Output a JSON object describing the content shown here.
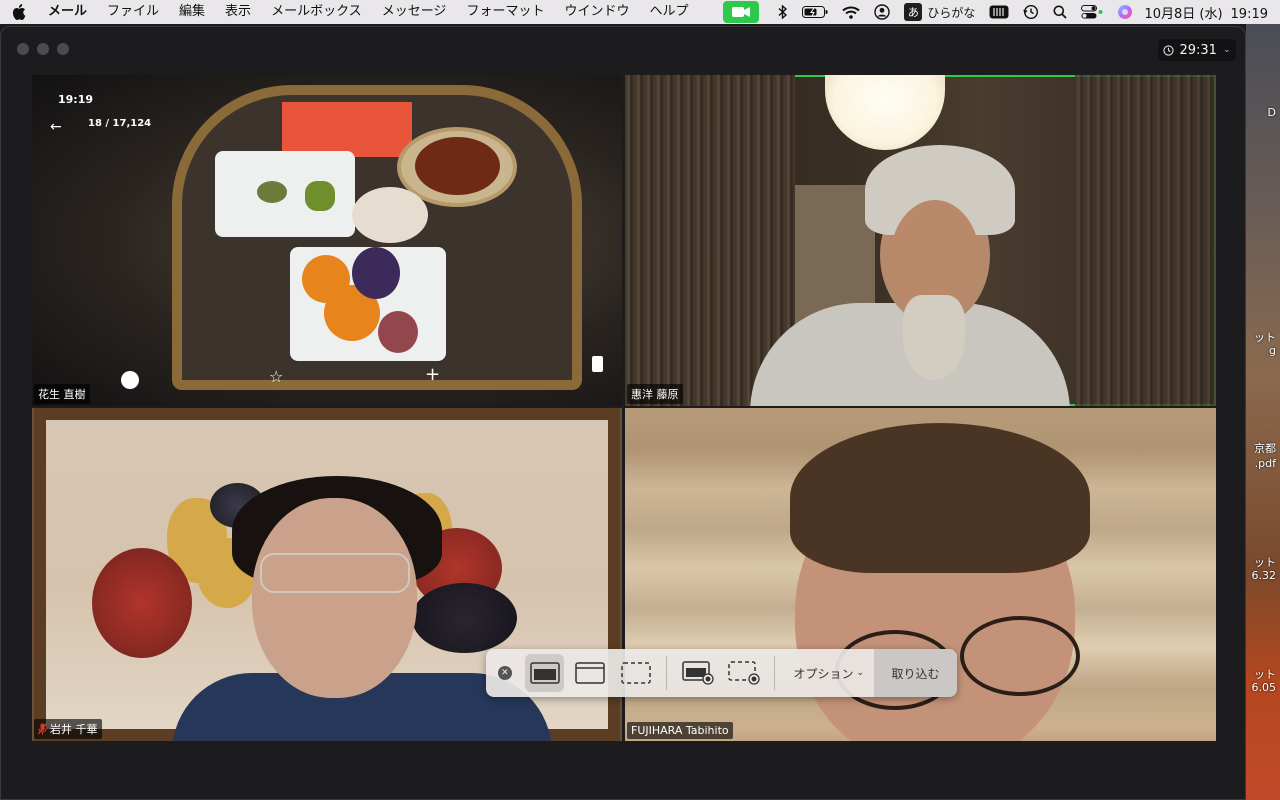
{
  "menubar": {
    "app_name": "メール",
    "items": [
      "ファイル",
      "編集",
      "表示",
      "メールボックス",
      "メッセージ",
      "フォーマット",
      "ウインドウ",
      "ヘルプ"
    ],
    "ime_char": "あ",
    "ime_label": "ひらがな",
    "date": "10月8日 (水)",
    "time": "19:19"
  },
  "zoom": {
    "meeting_timer": "29:31",
    "participants": [
      {
        "name": "花生 直樹",
        "muted": false,
        "active": false
      },
      {
        "name": "惠洋 藤原",
        "muted": false,
        "active": true
      },
      {
        "name": "岩井 千華",
        "muted": true,
        "active": false
      },
      {
        "name": "FUJIHARA Tabihito",
        "muted": false,
        "active": false
      }
    ],
    "shared_phone_screen": {
      "clock": "19:19",
      "photo_counter": "18 / 17,124"
    }
  },
  "capture_toolbar": {
    "options_label": "オプション",
    "capture_label": "取り込む"
  },
  "desktop": {
    "labels": [
      "D",
      "ット",
      "g",
      "京都",
      ".pdf",
      "ット",
      "6.32",
      "ット",
      "6.05"
    ]
  },
  "colors": {
    "active_speaker": "#2ec84b",
    "zoom_status": "#2ec84b"
  }
}
